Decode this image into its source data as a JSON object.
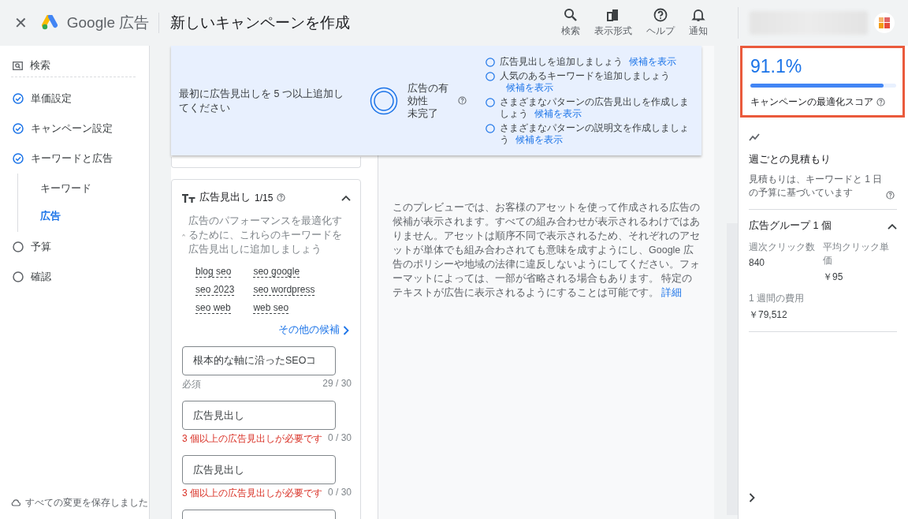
{
  "header": {
    "close": "✕",
    "brand": "Google 広告",
    "title": "新しいキャンペーンを作成",
    "actions": [
      {
        "kind": "search",
        "label": "検索"
      },
      {
        "kind": "view",
        "label": "表示形式"
      },
      {
        "kind": "help",
        "label": "ヘルプ"
      },
      {
        "kind": "bell",
        "label": "通知"
      }
    ]
  },
  "sidebar": {
    "steps": [
      {
        "kind": "type",
        "label": "検索"
      },
      {
        "kind": "step",
        "label": "単価設定",
        "completed": true
      },
      {
        "kind": "step",
        "label": "キャンペーン設定",
        "completed": true
      },
      {
        "kind": "step",
        "label": "キーワードと広告",
        "completed": true,
        "children": [
          {
            "label": "キーワード",
            "selected": false
          },
          {
            "label": "広告",
            "selected": true
          }
        ]
      },
      {
        "kind": "step",
        "label": "予算",
        "completed": false
      },
      {
        "kind": "step",
        "label": "確認",
        "completed": false
      }
    ],
    "save_status": "すべての変更を保存しました"
  },
  "banner": {
    "message": "最初に広告見出しを 5 つ以上追加してください",
    "strength_label": "広告の有効性",
    "strength_state": "未完了",
    "tips": [
      {
        "text": "広告見出しを追加しましょう",
        "link": "候補を表示"
      },
      {
        "text": "人気のあるキーワードを追加しましょう",
        "link": "候補を表示"
      },
      {
        "text": "さまざまなパターンの広告見出しを作成しましょう",
        "link": "候補を表示"
      },
      {
        "text": "さまざまなパターンの説明文を作成しましょう",
        "link": "候補を表示"
      }
    ]
  },
  "headlines": {
    "title": "広告見出し",
    "count": "1/15",
    "expanded": true,
    "suggestion": "広告のパフォーマンスを最適化するために、これらのキーワードを広告見出しに追加しましょう",
    "keywords": [
      "blog seo",
      "seo google",
      "seo 2023",
      "seo wordpress",
      "seo web",
      "web seo"
    ],
    "more_link": "その他の候補",
    "fields": [
      {
        "kind": "filled",
        "value": "根本的な軸に沿ったSEOコ",
        "helper": "必須",
        "counter": "29 / 30"
      },
      {
        "kind": "placeholder",
        "placeholder": "広告見出し",
        "error": "3 個以上の広告見出しが必要です",
        "counter": "0 / 30"
      },
      {
        "kind": "placeholder",
        "placeholder": "広告見出し",
        "error": "3 個以上の広告見出しが必要です",
        "counter": "0 / 30"
      },
      {
        "kind": "blank"
      }
    ]
  },
  "preview": {
    "text": "このプレビューでは、お客様のアセットを使って作成される広告の候補が表示されます。すべての組み合わせが表示されるわけではありません。アセットは順序不同で表示されるため、それぞれのアセットが単体でも組み合わされても意味を成すようにし、Google 広告のポリシーや地域の法律に違反しないようにしてください。フォーマットによっては、一部が省略される場合もあります。 特定のテキストが広告に表示されるようにすることは可能です。",
    "link": "詳細"
  },
  "score": {
    "value": "91.1%",
    "level": 0.911,
    "label": "キャンペーンの最適化スコア"
  },
  "estimate": {
    "title": "週ごとの見積もり",
    "subtitle": "見積もりは、キーワードと 1 日の予算に基づいています"
  },
  "ad_group": {
    "title": "広告グループ 1 個",
    "expanded": true,
    "metrics": [
      {
        "label": "週次クリック数",
        "value": "840"
      },
      {
        "label": "平均クリック単価",
        "value": "￥95"
      },
      {
        "label": "1 週間の費用",
        "value": "￥79,512"
      }
    ]
  }
}
